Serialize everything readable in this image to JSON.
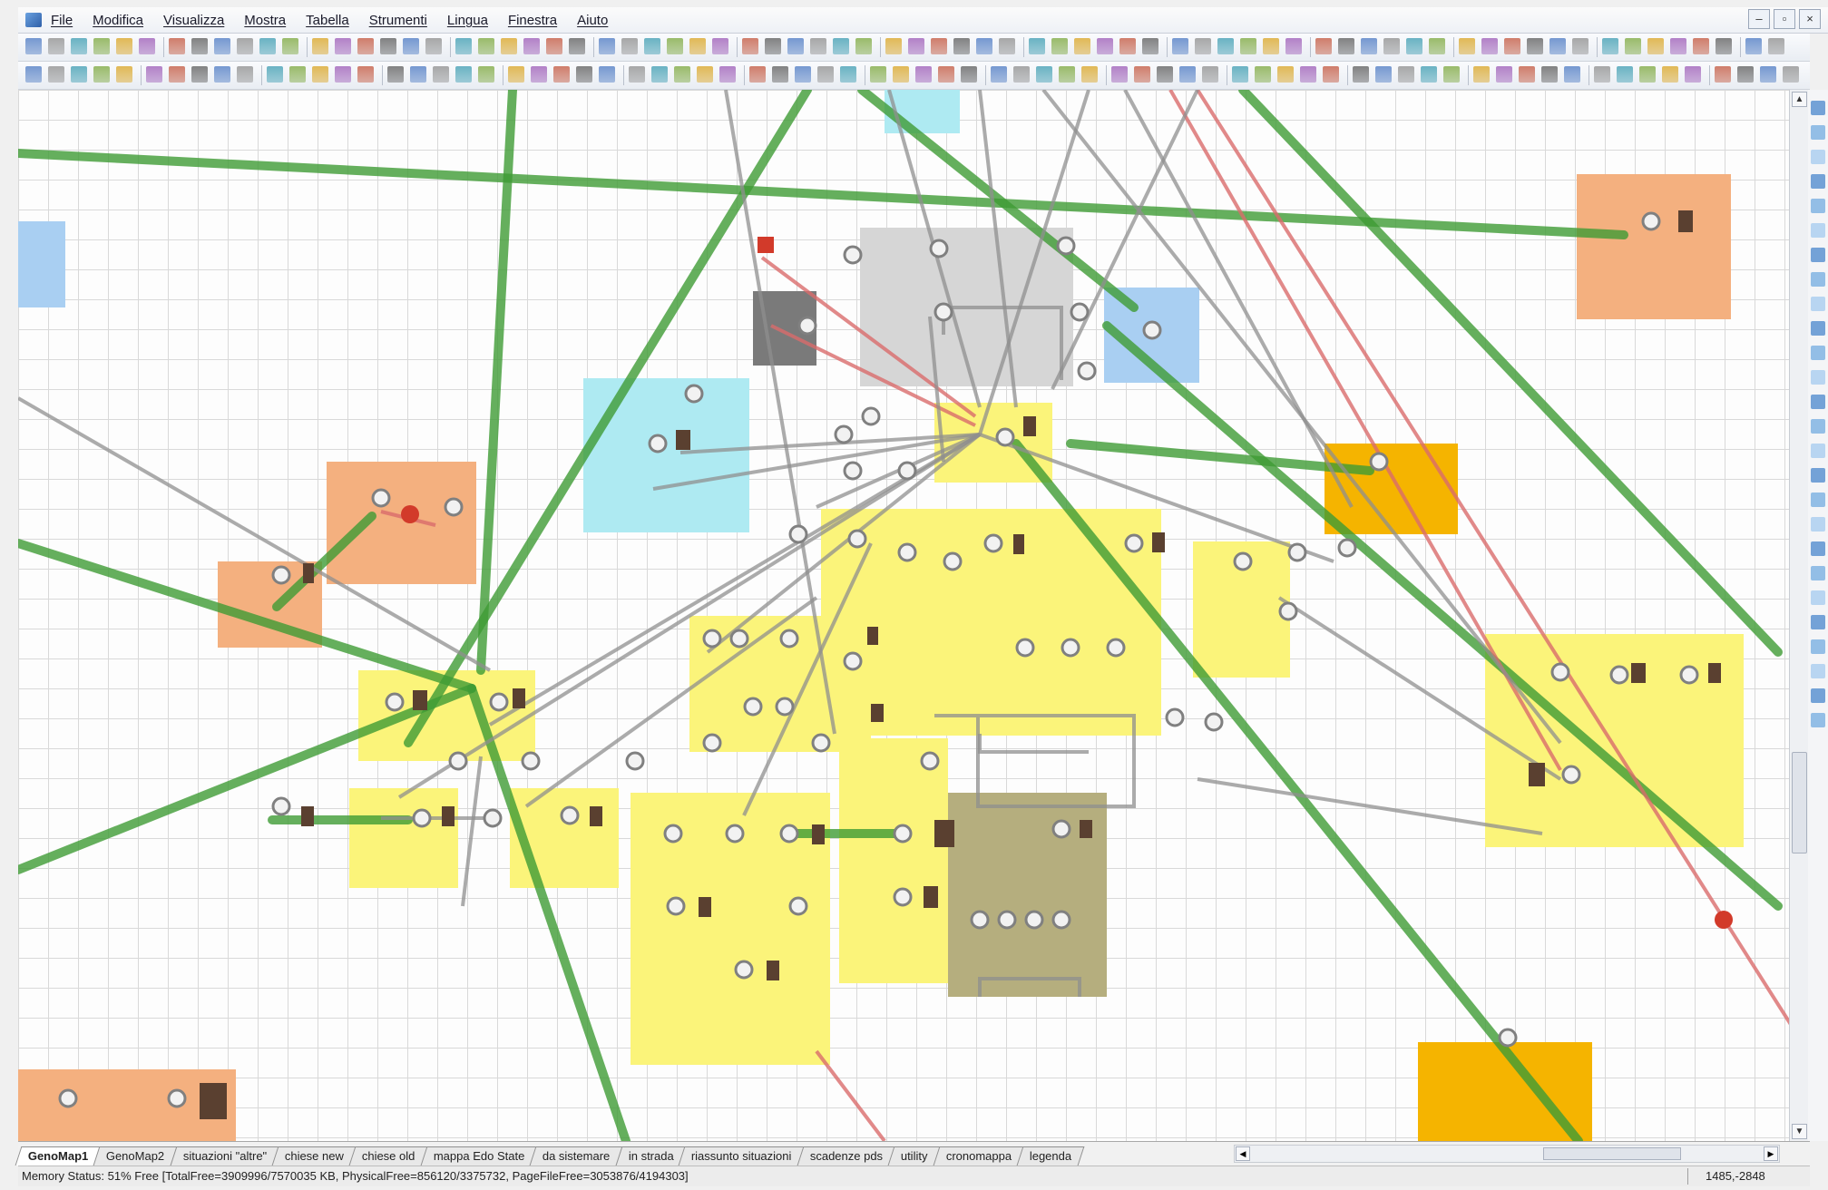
{
  "app": {
    "menu": [
      "File",
      "Modifica",
      "Visualizza",
      "Mostra",
      "Tabella",
      "Strumenti",
      "Lingua",
      "Finestra",
      "Aiuto"
    ],
    "window_controls": [
      "–",
      "▫",
      "×"
    ]
  },
  "tabs": [
    {
      "label": "GenoMap1",
      "active": true
    },
    {
      "label": "GenoMap2",
      "active": false
    },
    {
      "label": "situazioni \"altre\"",
      "active": false
    },
    {
      "label": "chiese new",
      "active": false
    },
    {
      "label": "chiese old",
      "active": false
    },
    {
      "label": "mappa Edo State",
      "active": false
    },
    {
      "label": "da sistemare",
      "active": false
    },
    {
      "label": "in strada",
      "active": false
    },
    {
      "label": "riassunto situazioni",
      "active": false
    },
    {
      "label": "scadenze pds",
      "active": false
    },
    {
      "label": "utility",
      "active": false
    },
    {
      "label": "cronomappa",
      "active": false
    },
    {
      "label": "legenda",
      "active": false
    }
  ],
  "status": {
    "memory": "Memory Status: 51% Free [TotalFree=3909996/7570035 KB, PhysicalFree=856120/3375732, PageFileFree=3053876/4194303]",
    "coords": "1485,-2848"
  },
  "colors": {
    "link_green": "#3f9b35",
    "link_gray": "#8f8f8f",
    "link_red": "#d96b6b",
    "card_yellow": "#fbf47a",
    "card_orange": "#f4b07f",
    "card_amber": "#f5b400",
    "card_cyan": "#aeeaf2",
    "card_blue": "#a9cff2",
    "card_gray": "#d6d6d6",
    "card_olive": "#b5ae7e"
  }
}
